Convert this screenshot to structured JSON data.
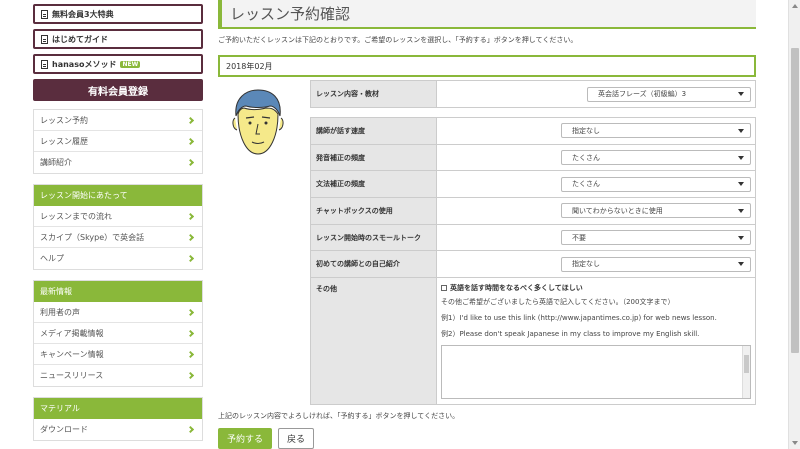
{
  "sidebar": {
    "top_buttons": [
      {
        "label": "無料会員3大特典"
      },
      {
        "label": "はじめてガイド"
      },
      {
        "label": "hanasoメソッド",
        "badge": "NEW"
      }
    ],
    "register": "有料会員登録",
    "menu1": [
      "レッスン予約",
      "レッスン履歴",
      "講師紹介"
    ],
    "group2": {
      "heading": "レッスン開始にあたって",
      "items": [
        "レッスンまでの流れ",
        "スカイプ（Skype）で英会話",
        "ヘルプ"
      ]
    },
    "group3": {
      "heading": "最新情報",
      "items": [
        "利用者の声",
        "メディア掲載情報",
        "キャンペーン情報",
        "ニュースリリース"
      ]
    },
    "group4": {
      "heading": "マテリアル",
      "items": [
        "ダウンロード"
      ]
    }
  },
  "main": {
    "title": "レッスン予約確認",
    "intro": "ご予約いただくレッスンは下記のとおりです。ご希望のレッスンを選択し、「予約する」ボタンを押してください。",
    "month": "2018年02月",
    "content": {
      "label": "レッスン内容・教材",
      "value": "英会話フレーズ（初級編）3"
    },
    "rows": [
      {
        "label": "講師が話す速度",
        "value": "指定なし"
      },
      {
        "label": "発音補正の頻度",
        "value": "たくさん"
      },
      {
        "label": "文法補正の頻度",
        "value": "たくさん"
      },
      {
        "label": "チャットボックスの使用",
        "value": "聞いてわからないときに使用"
      },
      {
        "label": "レッスン開始時のスモールトーク",
        "value": "不要"
      },
      {
        "label": "初めての講師との自己紹介",
        "value": "指定なし"
      }
    ],
    "other": {
      "label": "その他",
      "checkbox": "英語を話す時間をなるべく多くしてほしい",
      "note": "その他ご希望がございましたら英語で記入してください。（200文字まで）",
      "example1": "例1）I'd like to use this link (http://www.japantimes.co.jp) for web news lesson.",
      "example2": "例2）Please don't speak Japanese in my class to improve my English skill."
    },
    "confirm_text": "上記のレッスン内容でよろしければ、「予約する」ボタンを押してください。",
    "reserve_button": "予約する",
    "back_button": "戻る"
  },
  "colors": {
    "accent": "#8ab83a",
    "brand": "#5a2d3e"
  }
}
